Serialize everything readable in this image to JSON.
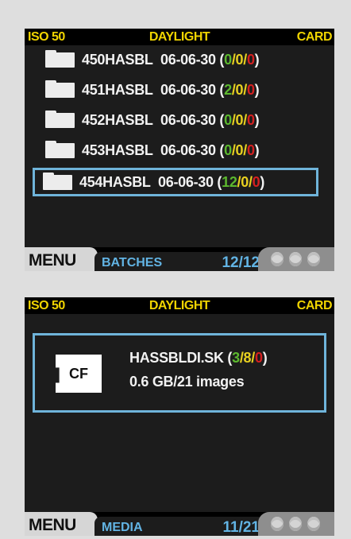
{
  "screens": [
    {
      "top_bar": {
        "iso": "ISO 50",
        "white_balance": "DAYLIGHT",
        "storage": "CARD"
      },
      "batches": [
        {
          "name": "450HASBL",
          "date": "06-06-30",
          "open": "(",
          "g": "0",
          "s1": "/",
          "y": "0",
          "s2": "/",
          "r": "0",
          "close": ")"
        },
        {
          "name": "451HASBL",
          "date": "06-06-30",
          "open": "(",
          "g": "2",
          "s1": "/",
          "y": "0",
          "s2": "/",
          "r": "0",
          "close": ")"
        },
        {
          "name": "452HASBL",
          "date": "06-06-30",
          "open": "(",
          "g": "0",
          "s1": "/",
          "y": "0",
          "s2": "/",
          "r": "0",
          "close": ")"
        },
        {
          "name": "453HASBL",
          "date": "06-06-30",
          "open": "(",
          "g": "0",
          "s1": "/",
          "y": "0",
          "s2": "/",
          "r": "0",
          "close": ")"
        },
        {
          "name": "454HASBL",
          "date": "06-06-30",
          "open": "(",
          "g": "12",
          "s1": "/",
          "y": "0",
          "s2": "/",
          "r": "0",
          "close": ")"
        }
      ],
      "bottom_bar": {
        "menu": "MENU",
        "tab": "BATCHES",
        "counter": "12/12"
      }
    },
    {
      "top_bar": {
        "iso": "ISO 50",
        "white_balance": "DAYLIGHT",
        "storage": "CARD"
      },
      "media": {
        "icon_label": "CF",
        "name": "HASSBLDI.SK",
        "open": "(",
        "g": "3",
        "s1": "/",
        "y": "8",
        "s2": "/",
        "r": "0",
        "close": ")",
        "info": "0.6 GB/21 images"
      },
      "bottom_bar": {
        "menu": "MENU",
        "tab": "MEDIA",
        "counter": "11/21"
      }
    }
  ],
  "colors": {
    "accent_yellow": "#f0d400",
    "selection_blue": "#6fb4da",
    "status_green": "#5cb82e",
    "status_yellow": "#e8d020",
    "status_red": "#d42020"
  },
  "icons": [
    "folder-icon",
    "cf-card-icon",
    "nav-dial-icon"
  ]
}
